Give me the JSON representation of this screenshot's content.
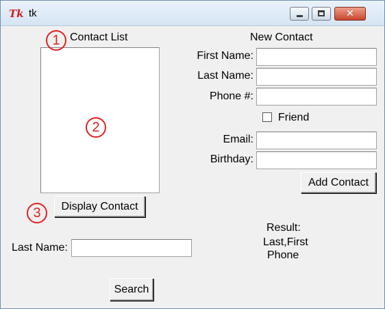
{
  "window": {
    "title": "tk",
    "logo": "Tk",
    "controls": {
      "minimize_icon": "minimize-icon",
      "maximize_icon": "maximize-icon",
      "close_icon": "close-icon",
      "close_glyph": "✕"
    }
  },
  "contact_list": {
    "heading": "Contact List",
    "display_button": "Display Contact"
  },
  "new_contact": {
    "heading": "New Contact",
    "first_name_label": "First Name:",
    "last_name_label": "Last Name:",
    "phone_label": "Phone #:",
    "friend_label": "Friend",
    "friend_checked": false,
    "email_label": "Email:",
    "birthday_label": "Birthday:",
    "add_button": "Add Contact",
    "first_name_value": "",
    "last_name_value": "",
    "phone_value": "",
    "email_value": "",
    "birthday_value": ""
  },
  "search": {
    "last_name_label": "Last Name:",
    "last_name_value": "",
    "button": "Search"
  },
  "result": {
    "heading": "Result:",
    "line1": "Last,First",
    "line2": "Phone"
  },
  "annotations": {
    "marker1": "1",
    "marker2": "2",
    "marker3": "3",
    "color": "#e02020"
  }
}
